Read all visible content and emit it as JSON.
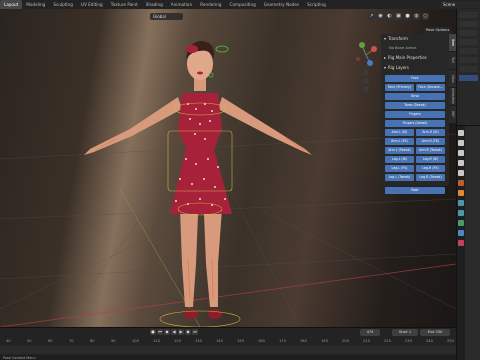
{
  "topbar": {
    "tabs": [
      "Layout",
      "Modeling",
      "Sculpting",
      "UV Editing",
      "Texture Paint",
      "Shading",
      "Animation",
      "Rendering",
      "Compositing",
      "Geometry Nodes",
      "Scripting"
    ],
    "active_tab": "Layout",
    "scene": "Scene"
  },
  "viewport": {
    "mode": "Global",
    "pose_options": "Pose Options",
    "header_icons": [
      "cursor-icon",
      "eye-icon",
      "overlay-icon",
      "xray-icon",
      "solid-shading-icon",
      "material-shading-icon",
      "rendered-shading-icon"
    ]
  },
  "npanel": {
    "transform_label": "Transform",
    "no_bone_label": "No Bone Active",
    "rig_main_label": "Rig Main Properties",
    "rig_layers_label": "Rig Layers",
    "buttons": {
      "face": "Face",
      "face_primary": "Face (Primary)",
      "face_secondary": "Face (Second...",
      "torso": "Torso",
      "torso_tweak": "Torso (Tweak)",
      "fingers": "Fingers",
      "fingers_detail": "Fingers (Detail)",
      "arm_l_ik": "Arm.L (IK)",
      "arm_r_ik": "Arm.R (IK)",
      "arm_l_fk": "Arm.L (FK)",
      "arm_r_fk": "Arm.R (FK)",
      "arm_l_tweak": "Arm.L (Tweak)",
      "arm_r_tweak": "Arm.R (Tweak)",
      "leg_l_ik": "Leg.L (IK)",
      "leg_r_ik": "Leg.R (IK)",
      "leg_l_fk": "Leg.L (FK)",
      "leg_r_fk": "Leg.R (FK)",
      "leg_l_tweak": "Leg.L (Tweak)",
      "leg_r_tweak": "Leg.R (Tweak)",
      "root": "Root"
    },
    "side_tabs": [
      "Item",
      "Tool",
      "View",
      "Animation",
      "BBP"
    ]
  },
  "timeline": {
    "current_frame": "474",
    "start_label": "Start",
    "start_value": "1",
    "end_label": "End",
    "end_value": "250",
    "ruler": [
      "40",
      "50",
      "60",
      "70",
      "80",
      "90",
      "100",
      "110",
      "120",
      "130",
      "140",
      "150",
      "160",
      "170",
      "180",
      "190",
      "200",
      "210",
      "220",
      "230",
      "240",
      "250"
    ],
    "status": "Pose Context Menu"
  },
  "colors": {
    "accent": "#4772b3",
    "dress": "#a8213b",
    "skin": "#d89a7c"
  }
}
